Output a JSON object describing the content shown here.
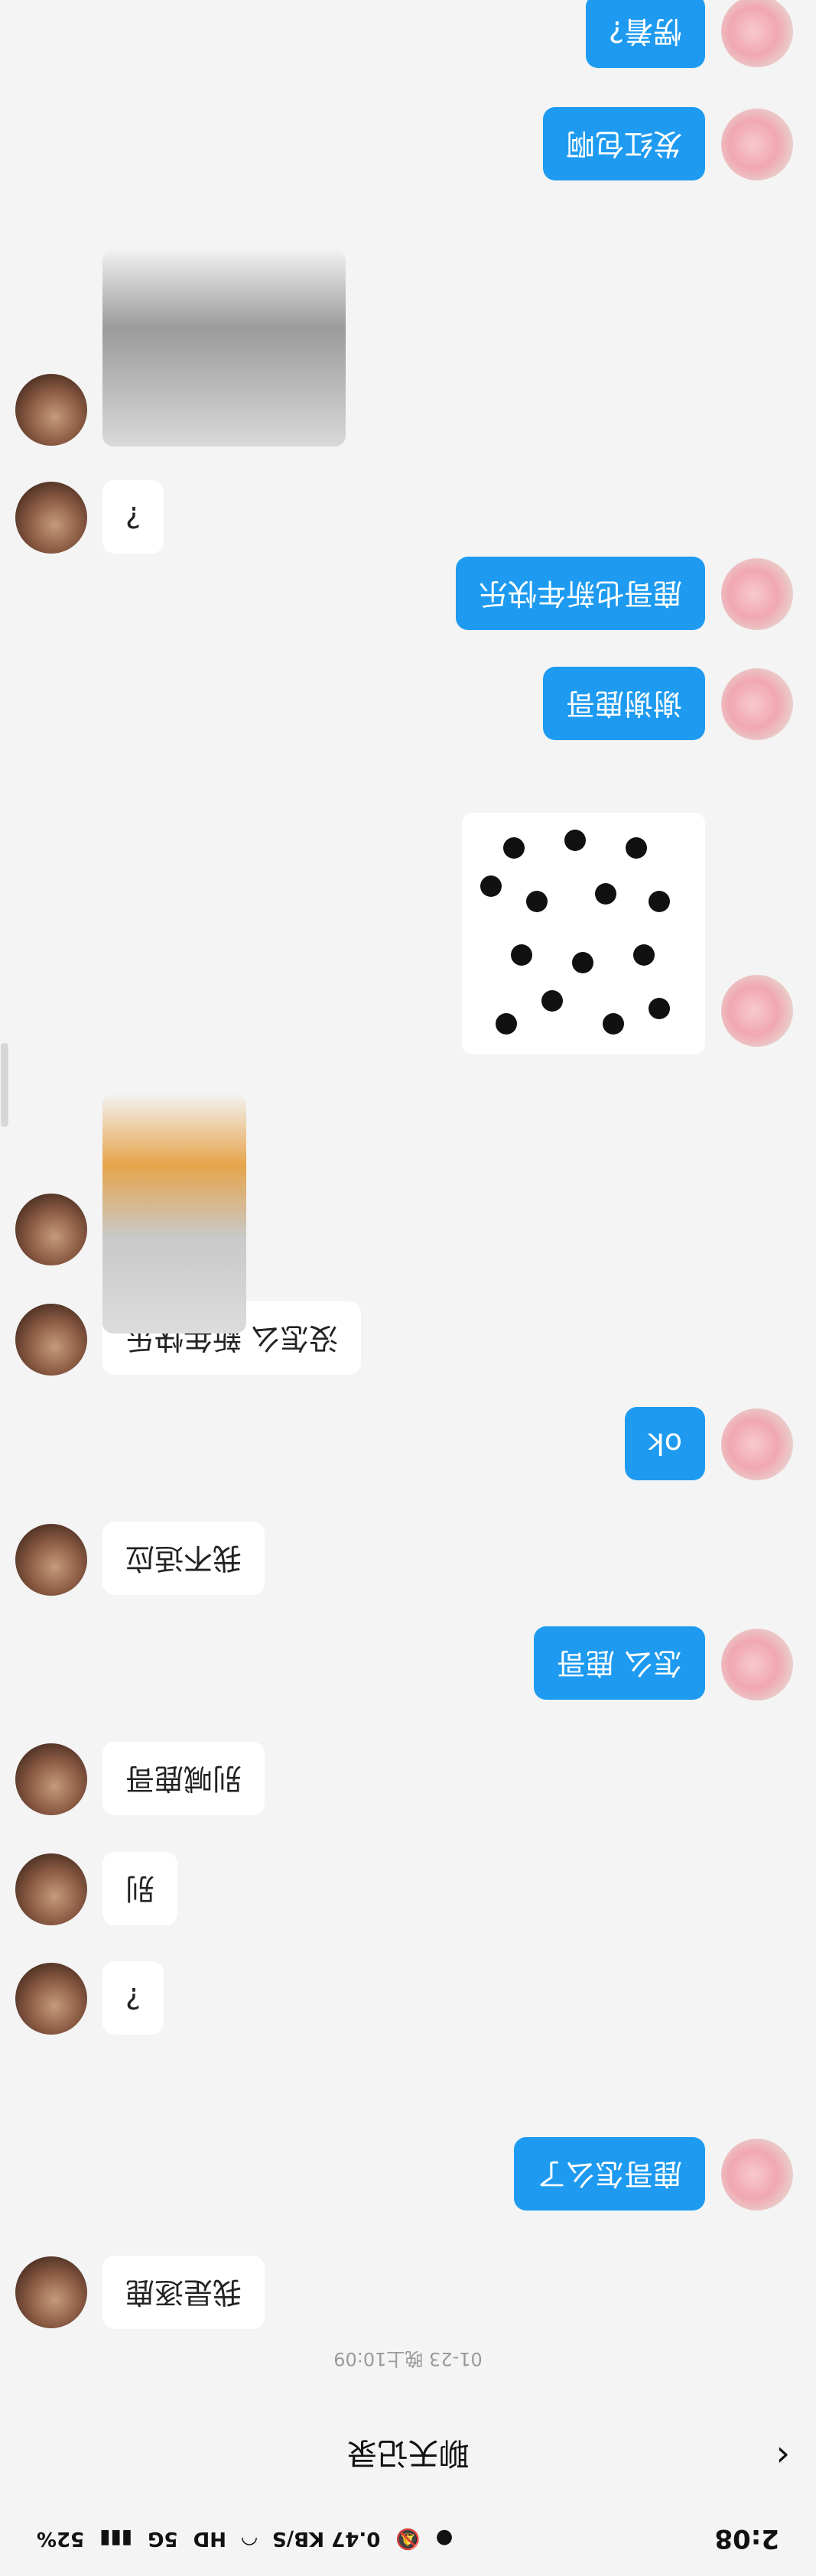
{
  "statusbar": {
    "time": "2:08",
    "speed": "0.47 KB/S",
    "hd": "HD",
    "network": "5G",
    "battery": "52%"
  },
  "header": {
    "title": "聊天记录",
    "back_icon": "chevron-left-icon"
  },
  "timestamp": "01-23 晚上10:09",
  "messages": [
    {
      "sender": "me",
      "type": "text",
      "text": "我是逐鹿"
    },
    {
      "sender": "other",
      "type": "text",
      "text": "鹿哥怎么了"
    },
    {
      "sender": "me",
      "type": "text",
      "text": "?"
    },
    {
      "sender": "me",
      "type": "text",
      "text": "别"
    },
    {
      "sender": "me",
      "type": "text",
      "text": "别喊鹿哥"
    },
    {
      "sender": "other",
      "type": "text",
      "text": "怎么 鹿哥"
    },
    {
      "sender": "me",
      "type": "text",
      "text": "我不适应"
    },
    {
      "sender": "other",
      "type": "text",
      "text": "ok"
    },
    {
      "sender": "me",
      "type": "text",
      "text": "没怎么 新年快乐"
    },
    {
      "sender": "me",
      "type": "image",
      "text": "corgi sticker"
    },
    {
      "sender": "other",
      "type": "image",
      "text": "panda sticker"
    },
    {
      "sender": "other",
      "type": "text",
      "text": "谢谢鹿哥"
    },
    {
      "sender": "other",
      "type": "text",
      "text": "鹿哥也新年快乐"
    },
    {
      "sender": "me",
      "type": "text",
      "text": "?"
    },
    {
      "sender": "me",
      "type": "image",
      "text": "cat sticker"
    },
    {
      "sender": "other",
      "type": "text",
      "text": "发红包啊"
    },
    {
      "sender": "other",
      "type": "text",
      "text": "愣着?"
    }
  ]
}
